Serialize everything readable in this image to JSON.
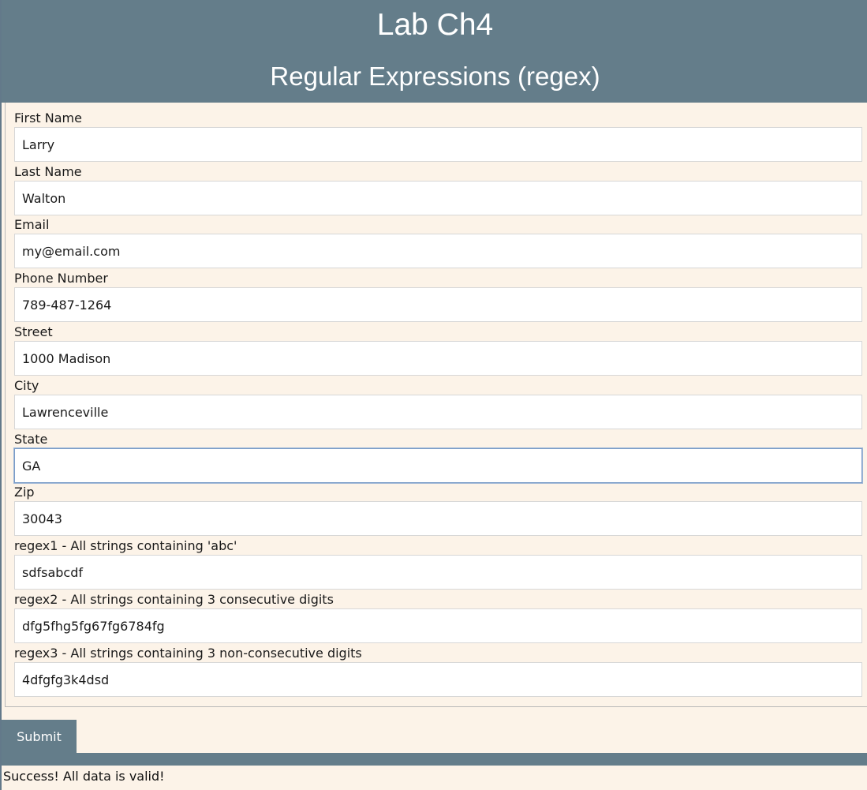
{
  "header": {
    "title": "Lab Ch4",
    "subtitle": "Regular Expressions (regex)"
  },
  "form": {
    "fields": [
      {
        "label": "First Name",
        "value": "Larry"
      },
      {
        "label": "Last Name",
        "value": "Walton"
      },
      {
        "label": "Email",
        "value": "my@email.com"
      },
      {
        "label": "Phone Number",
        "value": "789-487-1264"
      },
      {
        "label": "Street",
        "value": "1000 Madison"
      },
      {
        "label": "City",
        "value": "Lawrenceville"
      },
      {
        "label": "State",
        "value": "GA"
      },
      {
        "label": "Zip",
        "value": "30043"
      },
      {
        "label": "regex1 - All strings containing 'abc'",
        "value": "sdfsabcdf"
      },
      {
        "label": "regex2 - All strings containing 3 consecutive digits",
        "value": "dfg5fhg5fg67fg6784fg"
      },
      {
        "label": "regex3 - All strings containing 3 non-consecutive digits",
        "value": "4dfgfg3k4dsd"
      }
    ],
    "submit_label": "Submit"
  },
  "status": {
    "message": "Success! All data is valid!"
  },
  "colors": {
    "header_bg": "#647d8a",
    "page_bg": "#fcf3e8",
    "focus_border": "#7a9cc8"
  }
}
